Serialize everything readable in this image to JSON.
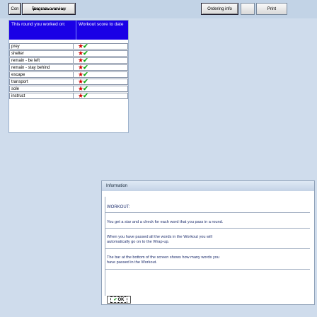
{
  "toolbar": {
    "con_label": "Con",
    "overview_label": "Program overview",
    "ordering_label": "Ordering info",
    "blank_label": "",
    "print_label": "Print"
  },
  "rounds_table": {
    "header_round": "This round you worked on:",
    "header_score": "Workout score to date",
    "rows": [
      {
        "word": "prey"
      },
      {
        "word": "shelter"
      },
      {
        "word": "remain - be left"
      },
      {
        "word": "remain - stay behind"
      },
      {
        "word": "escape"
      },
      {
        "word": "transport"
      },
      {
        "word": "sole"
      },
      {
        "word": "instruct"
      }
    ]
  },
  "info_dialog": {
    "title": "Information",
    "heading": "WORKOUT:",
    "p1": "You get a star and a check for each word that you pass in a round.",
    "p2_line1": "When you have passed all the words in the Workout you will",
    "p2_line2": "automatically go on to the Wrap-up.",
    "p3_line1": "The bar at the bottom of the screen shows how many words you",
    "p3_line2": "have passed in the Workout.",
    "ok_label": "OK"
  },
  "colors": {
    "header_bg": "#1a00e6",
    "star": "#d40000",
    "check": "#14a814",
    "text_blue": "#1f2f6e"
  }
}
